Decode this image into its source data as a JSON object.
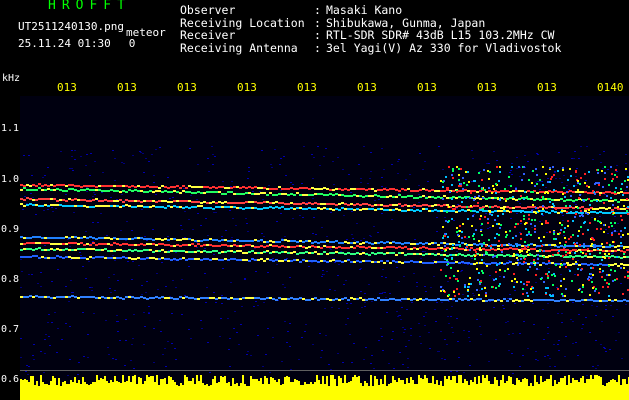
{
  "header": {
    "brand": "HROFFT",
    "filename": "UT2511240130.png",
    "mode_tag": "meteor",
    "date": "25.11.24 01:30",
    "count": "0",
    "meta_rows": [
      {
        "key": "Observer",
        "sep": ":",
        "value": "Masaki Kano"
      },
      {
        "key": "Receiving Location",
        "sep": ":",
        "value": "Shibukawa, Gunma, Japan"
      },
      {
        "key": "Receiver",
        "sep": ":",
        "value": "RTL-SDR SDR# 43dB L15 103.2MHz CW"
      },
      {
        "key": "Receiving Antenna",
        "sep": ":",
        "value": "3el Yagi(V) Az 330 for Vladivostok"
      }
    ]
  },
  "x_axis": {
    "labels": [
      "013",
      "013",
      "013",
      "013",
      "013",
      "013",
      "013",
      "013",
      "013",
      "0140"
    ]
  },
  "y_axis": {
    "unit": "kHz",
    "labels": [
      "1.1",
      "1.0",
      "0.9",
      "0.8",
      "0.7",
      "0.6"
    ]
  },
  "colors": {
    "brand": "#00ff00",
    "time_labels": "#ffff00",
    "text": "#ffffff",
    "background": "#000000",
    "noise_floor": "#000050"
  }
}
